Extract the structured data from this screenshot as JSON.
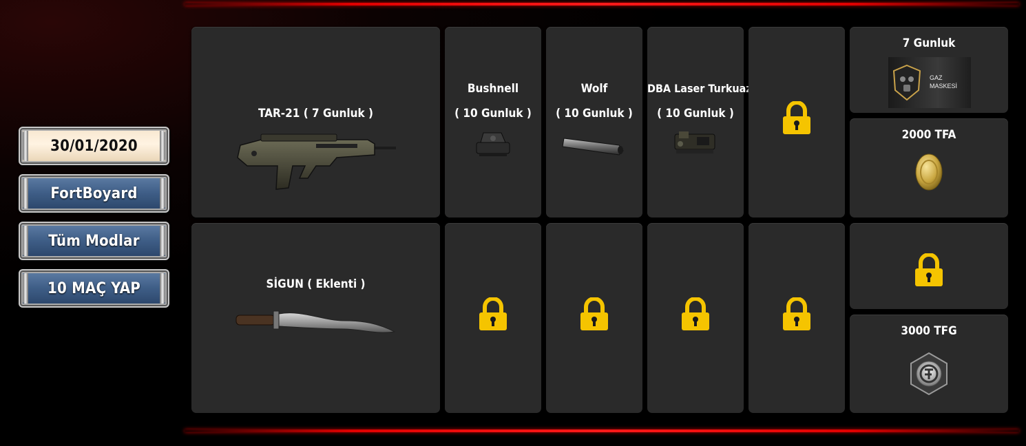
{
  "sidebar": {
    "date": "30/01/2020",
    "buttons": [
      "FortBoyard",
      "Tüm Modlar",
      "10 MAÇ YAP"
    ]
  },
  "rewards": {
    "row1": {
      "main": {
        "label": "TAR-21 ( 7 Gunluk )",
        "icon": "assault-rifle-icon"
      },
      "attachments": [
        {
          "name": "Bushnell",
          "duration": "( 10 Gunluk )",
          "icon": "red-dot-sight-icon"
        },
        {
          "name": "Wolf",
          "duration": "( 10 Gunluk )",
          "icon": "silencer-icon"
        },
        {
          "name": "DBA Laser Turkuaz",
          "duration": "( 10 Gunluk )",
          "icon": "laser-module-icon"
        },
        {
          "locked": true,
          "icon": "padlock-icon"
        }
      ],
      "side": [
        {
          "label": "7 Gunluk",
          "badge_text": [
            "GAZ",
            "MASKESİ"
          ],
          "icon": "gas-mask-icon"
        },
        {
          "label": "2000 TFA",
          "icon": "gold-coin-icon"
        }
      ]
    },
    "row2": {
      "main": {
        "label": "SİGUN ( Eklenti )",
        "icon": "knife-icon"
      },
      "attachments": [
        {
          "locked": true,
          "icon": "padlock-icon"
        },
        {
          "locked": true,
          "icon": "padlock-icon"
        },
        {
          "locked": true,
          "icon": "padlock-icon"
        },
        {
          "locked": true,
          "icon": "padlock-icon"
        }
      ],
      "side": [
        {
          "locked": true,
          "icon": "padlock-icon"
        },
        {
          "label": "3000 TFG",
          "icon": "tfg-token-icon"
        }
      ]
    }
  },
  "colors": {
    "accent_red": "#e00000",
    "lock_yellow": "#f5c400",
    "card_bg": "#2a2a2a"
  }
}
